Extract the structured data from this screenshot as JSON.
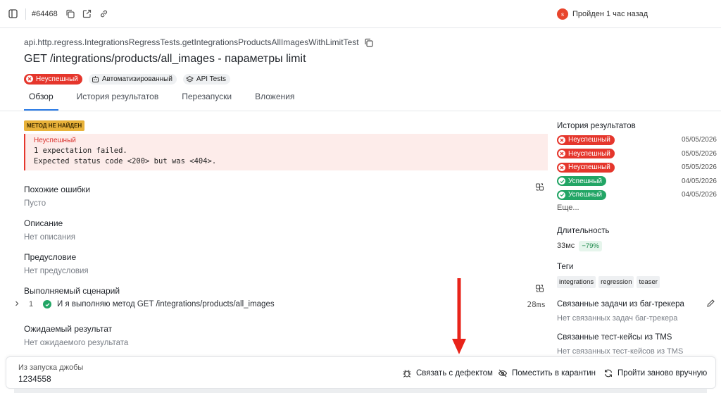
{
  "topbar": {
    "test_id": "#64468",
    "avatar_letter": "s",
    "status_text": "Пройден 1 час назад"
  },
  "header": {
    "path": "api.http.regress.IntegrationsRegressTests.getIntegrationsProductsAllImagesWithLimitTest",
    "title": "GET /integrations/products/all_images - параметры limit",
    "badges": [
      "Неуспешный",
      "Автоматизированный",
      "API Tests"
    ]
  },
  "tabs": [
    "Обзор",
    "История результатов",
    "Перезапуски",
    "Вложения"
  ],
  "error": {
    "tag": "МЕТОД НЕ НАЙДЕН",
    "title": "Неуспешный",
    "line1": "1 expectation failed.",
    "line2": "Expected status code <200> but was <404>."
  },
  "sections": {
    "similar": {
      "title": "Похожие ошибки",
      "value": "Пусто"
    },
    "description": {
      "title": "Описание",
      "value": "Нет описания"
    },
    "precondition": {
      "title": "Предусловие",
      "value": "Нет предусловия"
    },
    "scenario": {
      "title": "Выполняемый сценарий",
      "step_number": "1",
      "step_text": "И я выполняю метод GET /integrations/products/all_images",
      "step_duration": "28ms"
    },
    "expected": {
      "title": "Ожидаемый результат",
      "value": "Нет ожидаемого результата"
    }
  },
  "sidebar": {
    "history_title": "История результатов",
    "history": [
      {
        "status": "Неуспешный",
        "kind": "fail",
        "date": "05/05/2026"
      },
      {
        "status": "Неуспешный",
        "kind": "fail",
        "date": "05/05/2026"
      },
      {
        "status": "Неуспешный",
        "kind": "fail",
        "date": "05/05/2026"
      },
      {
        "status": "Успешный",
        "kind": "ok",
        "date": "04/05/2026"
      },
      {
        "status": "Успешный",
        "kind": "ok",
        "date": "04/05/2026"
      }
    ],
    "more": "Еще...",
    "duration_title": "Длительность",
    "duration_value": "33мс",
    "duration_delta": "−79%",
    "tags_title": "Теги",
    "tags": [
      "integrations",
      "regression",
      "teaser"
    ],
    "bugtracker_title": "Связанные задачи из баг-трекера",
    "bugtracker_value": "Нет связанных задач баг-трекера",
    "tms_title": "Связанные тест-кейсы из TMS",
    "tms_value": "Нет связанных тест-кейсов из TMS"
  },
  "footer": {
    "job_label": "Из запуска джобы",
    "job_value": "1234558",
    "link_defect": "Связать с дефектом",
    "quarantine": "Поместить в карантин",
    "rerun_manual": "Пройти заново вручную"
  },
  "colors": {
    "fail": "#e5362c",
    "success": "#22a565",
    "accent": "#2c7be5",
    "annotation_arrow": "#e8231a"
  }
}
